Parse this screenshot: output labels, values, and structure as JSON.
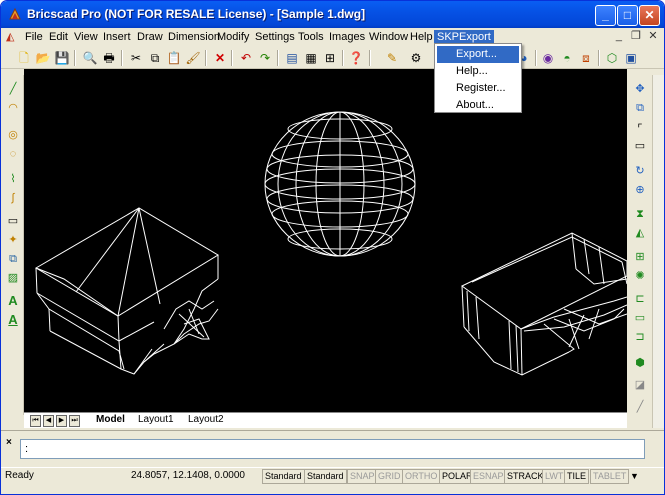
{
  "titlebar": {
    "title": "Bricscad Pro (NOT FOR RESALE License) - [Sample 1.dwg]",
    "minimize": "_",
    "maximize": "□",
    "close": "✕"
  },
  "menu": [
    "File",
    "Edit",
    "View",
    "Insert",
    "Draw",
    "Dimension",
    "Modify",
    "Settings",
    "Tools",
    "Images",
    "Window",
    "Help",
    "SKPExport"
  ],
  "mdi": {
    "min": "_",
    "restore": "❐",
    "close": "✕"
  },
  "dropdown": {
    "items": [
      "Export...",
      "Help...",
      "Register...",
      "About..."
    ]
  },
  "layout_tabs": [
    "Model",
    "Layout1",
    "Layout2"
  ],
  "nav_buttons": [
    "⏮",
    "◀",
    "▶",
    "⏭"
  ],
  "command": {
    "prefix": "×",
    "prompt": ":"
  },
  "status": {
    "text": "Ready",
    "coords": "24.8057, 12.1408, 0.0000",
    "buttons": [
      {
        "label": "Standard",
        "on": true
      },
      {
        "label": "Standard",
        "on": true
      },
      {
        "label": "SNAP",
        "on": false
      },
      {
        "label": "GRID",
        "on": false
      },
      {
        "label": "ORTHO",
        "on": false
      },
      {
        "label": "POLAR",
        "on": true
      },
      {
        "label": "ESNAP",
        "on": false
      },
      {
        "label": "STRACK",
        "on": true
      },
      {
        "label": "LWT",
        "on": false
      },
      {
        "label": "TILE",
        "on": true
      },
      {
        "label": "TABLET",
        "on": false
      }
    ]
  },
  "colors": {
    "titlebar": "#0a5ef3",
    "menu_highlight": "#316ac5",
    "canvas": "#000000",
    "wire": "#ffffff"
  }
}
